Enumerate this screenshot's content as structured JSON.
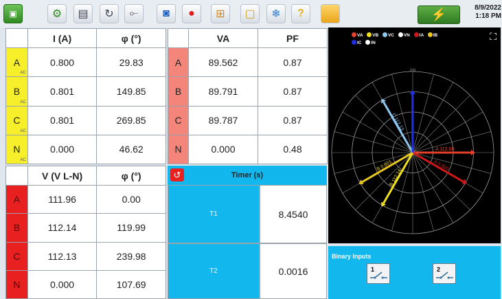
{
  "toolbar": {
    "icons": [
      "home-icon",
      "settings-icon",
      "table-icon",
      "loop-icon",
      "switch-icon",
      "camera-icon",
      "record-icon",
      "grid-icon",
      "window-icon",
      "fan-icon",
      "help-icon",
      "folder-icon"
    ],
    "date": "8/9/2022",
    "time": "1:18 PM"
  },
  "current_table": {
    "headers": [
      "I (A)",
      "φ (°)"
    ],
    "rows": [
      {
        "phase": "A",
        "sub": "AC",
        "value": "0.800",
        "angle": "29.83"
      },
      {
        "phase": "B",
        "sub": "AC",
        "value": "0.801",
        "angle": "149.85"
      },
      {
        "phase": "C",
        "sub": "AC",
        "value": "0.801",
        "angle": "269.85"
      },
      {
        "phase": "N",
        "sub": "AC",
        "value": "0.000",
        "angle": "46.62"
      }
    ]
  },
  "power_table": {
    "headers": [
      "VA",
      "PF"
    ],
    "rows": [
      {
        "phase": "A",
        "va": "89.562",
        "pf": "0.87"
      },
      {
        "phase": "B",
        "va": "89.791",
        "pf": "0.87"
      },
      {
        "phase": "C",
        "va": "89.787",
        "pf": "0.87"
      },
      {
        "phase": "N",
        "va": "0.000",
        "pf": "0.48"
      }
    ]
  },
  "voltage_table": {
    "headers": [
      "V (V L-N)",
      "φ (°)"
    ],
    "rows": [
      {
        "phase": "A",
        "value": "111.96",
        "angle": "0.00"
      },
      {
        "phase": "B",
        "value": "112.14",
        "angle": "119.99"
      },
      {
        "phase": "C",
        "value": "112.13",
        "angle": "239.98"
      },
      {
        "phase": "N",
        "value": "0.000",
        "angle": "107.69"
      }
    ]
  },
  "timer": {
    "title": "Timer (s)",
    "rows": [
      {
        "name": "T1",
        "value": "8.4540"
      },
      {
        "name": "T2",
        "value": "0.0016"
      }
    ]
  },
  "phasor": {
    "legend": [
      {
        "label": "VA",
        "color": "#e8402a"
      },
      {
        "label": "VB",
        "color": "#f0e020"
      },
      {
        "label": "VC",
        "color": "#8ec8f0"
      },
      {
        "label": "VN",
        "color": "#ffffff"
      },
      {
        "label": "IA",
        "color": "#d01818"
      },
      {
        "label": "IB",
        "color": "#e8c820"
      },
      {
        "label": "IC",
        "color": "#2030e8"
      },
      {
        "label": "IN",
        "color": "#ffffff"
      }
    ],
    "top_label": "270",
    "vectors": [
      {
        "name": "VA",
        "text": "A 112.00",
        "angle_deg": 0,
        "magnitude": 1.0,
        "color": "#e8402a"
      },
      {
        "name": "IA",
        "text": "A 0.800",
        "angle_deg": 29.83,
        "magnitude": 1.0,
        "color": "#d01818"
      },
      {
        "name": "VB",
        "text": "B 112.14",
        "angle_deg": 119.99,
        "magnitude": 1.0,
        "color": "#f0e020"
      },
      {
        "name": "IB",
        "text": "B 0.801",
        "angle_deg": 149.85,
        "magnitude": 1.0,
        "color": "#e8c820"
      },
      {
        "name": "VC",
        "text": "C 112.13",
        "angle_deg": 239.98,
        "magnitude": 1.0,
        "color": "#8ec8f0"
      },
      {
        "name": "IC",
        "text": "",
        "angle_deg": 269.85,
        "magnitude": 1.0,
        "color": "#2030e8"
      }
    ]
  },
  "binary_inputs": {
    "title": "Binary Inputs",
    "inputs": [
      "1",
      "2"
    ]
  }
}
